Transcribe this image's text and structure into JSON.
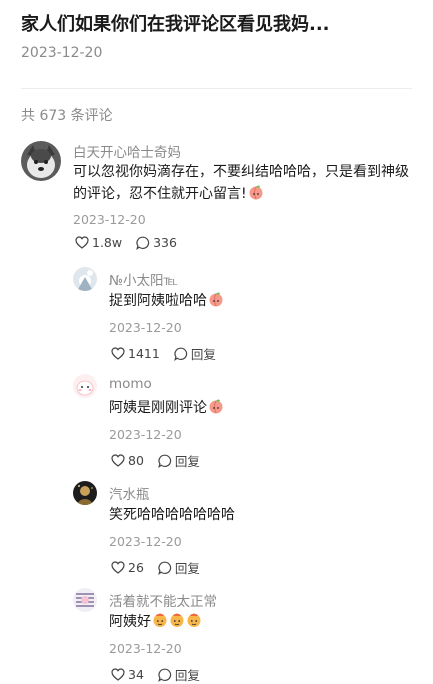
{
  "post": {
    "title": "家人们如果你们在我评论区看见我妈...",
    "date": "2023-12-20",
    "comment_count": "共 673 条评论"
  },
  "comments": [
    {
      "user": "白天开心哈士奇妈",
      "text_line1": "可以忽视你妈滴存在，不要纠结哈哈哈，只是看到神级",
      "text_line2": "的评论，忍不住就开心留言!",
      "emoji": "peach-emoji",
      "date": "2023-12-20",
      "likes": "1.8w",
      "replies": "336"
    },
    {
      "user": "№小太阳℡",
      "text": "捉到阿姨啦哈哈",
      "emoji": "peach-emoji",
      "date": "2023-12-20",
      "likes": "1411",
      "reply_label": "回复"
    },
    {
      "user": "momo",
      "text": "阿姨是刚刚评论",
      "emoji": "peach-emoji",
      "date": "2023-12-20",
      "likes": "80",
      "reply_label": "回复"
    },
    {
      "user": "汽水瓶",
      "text": "笑死哈哈哈哈哈哈哈",
      "date": "2023-12-20",
      "likes": "26",
      "reply_label": "回复"
    },
    {
      "user": "活着就不能太正常",
      "text": "阿姨好",
      "emoji": "hot-face-emoji",
      "date": "2023-12-20",
      "likes": "34",
      "reply_label": "回复"
    }
  ],
  "colors": {
    "muted_text": "#8a8a8a",
    "main_text": "#1a1a1a",
    "peach": "#f08a7a"
  }
}
